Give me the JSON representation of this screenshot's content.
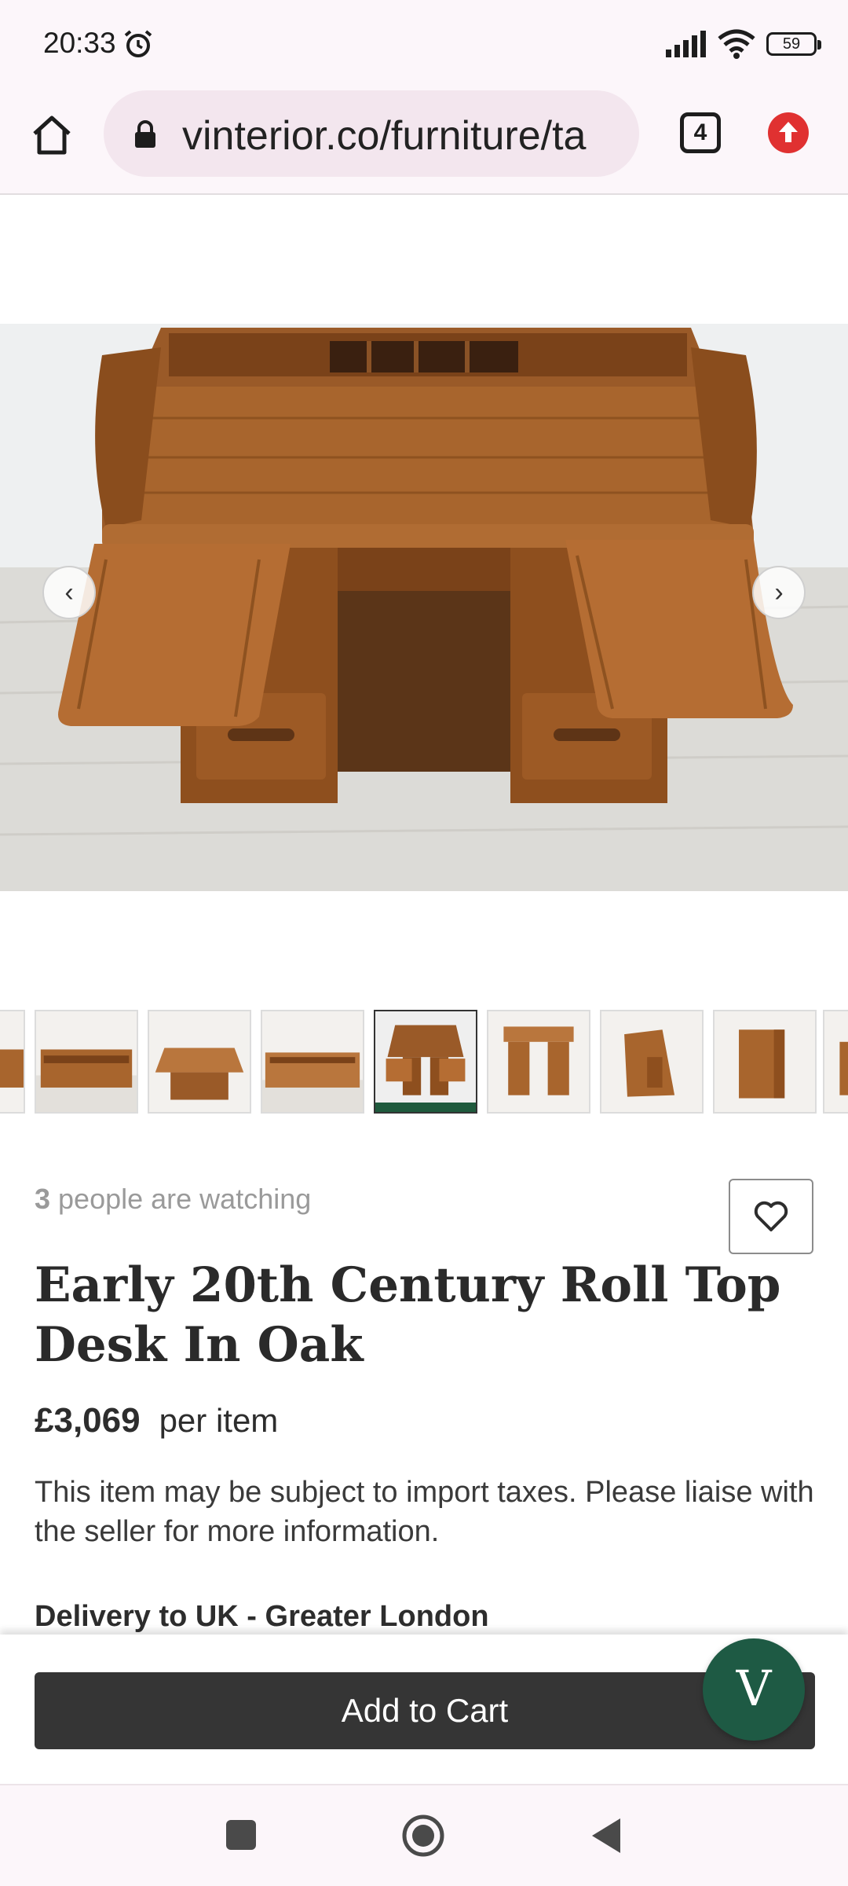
{
  "status_bar": {
    "time": "20:33",
    "battery": "59",
    "icons": [
      "alarm-icon",
      "signal-icon",
      "wifi-icon",
      "battery-icon"
    ]
  },
  "browser": {
    "url": "vinterior.co/furniture/ta",
    "tab_count": "4",
    "icons": [
      "home-icon",
      "lock-icon",
      "tabs-icon",
      "update-arrow-icon"
    ]
  },
  "gallery": {
    "prev_icon": "chevron-left-icon",
    "next_icon": "chevron-right-icon",
    "prev_glyph": "‹",
    "next_glyph": "›",
    "active_thumbnail": 4,
    "thumbnail_count": 9
  },
  "product": {
    "watching_count": "3",
    "watching_text": " people are watching",
    "title": "Early 20th Century Roll Top Desk In Oak",
    "price": "£3,069",
    "price_unit": "per item",
    "tax_note": "This item may be subject to import taxes. Please liaise with the seller for more information.",
    "delivery_label": "Delivery to UK - Greater London"
  },
  "actions": {
    "add_to_cart": "Add to Cart",
    "chat_letter": "V"
  },
  "colors": {
    "accent_green": "#1e5a44",
    "button_dark": "#353535",
    "update_red": "#e03131"
  }
}
